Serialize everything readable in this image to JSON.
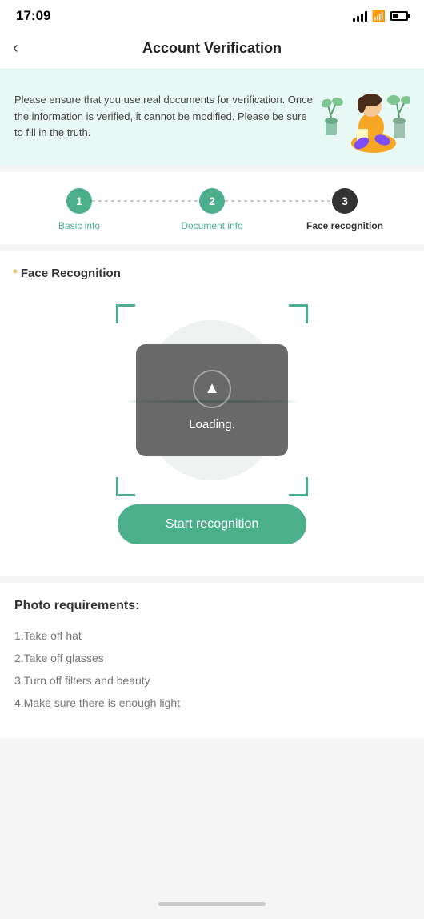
{
  "statusBar": {
    "time": "17:09"
  },
  "header": {
    "back_label": "<",
    "title": "Account Verification"
  },
  "banner": {
    "text": "Please ensure that you use real documents for verification. Once the information is verified, it cannot be modified. Please be sure to fill in the truth."
  },
  "steps": {
    "items": [
      {
        "number": "1",
        "label": "Basic info",
        "state": "active"
      },
      {
        "number": "2",
        "label": "Document info",
        "state": "active"
      },
      {
        "number": "3",
        "label": "Face recognition",
        "state": "current"
      }
    ]
  },
  "faceSection": {
    "asterisk": "*",
    "title": "Face Recognition",
    "loading_text": "Loading.",
    "start_button": "Start recognition"
  },
  "requirements": {
    "title": "Photo requirements:",
    "items": [
      "1.Take off hat",
      "2.Take off glasses",
      "3.Turn off filters and beauty",
      "4.Make sure there is enough light"
    ]
  },
  "colors": {
    "accent": "#4CAF8C",
    "stepActive": "#4CAF8C",
    "stepCurrent": "#333333",
    "bannerBg": "#e8f8f5"
  }
}
